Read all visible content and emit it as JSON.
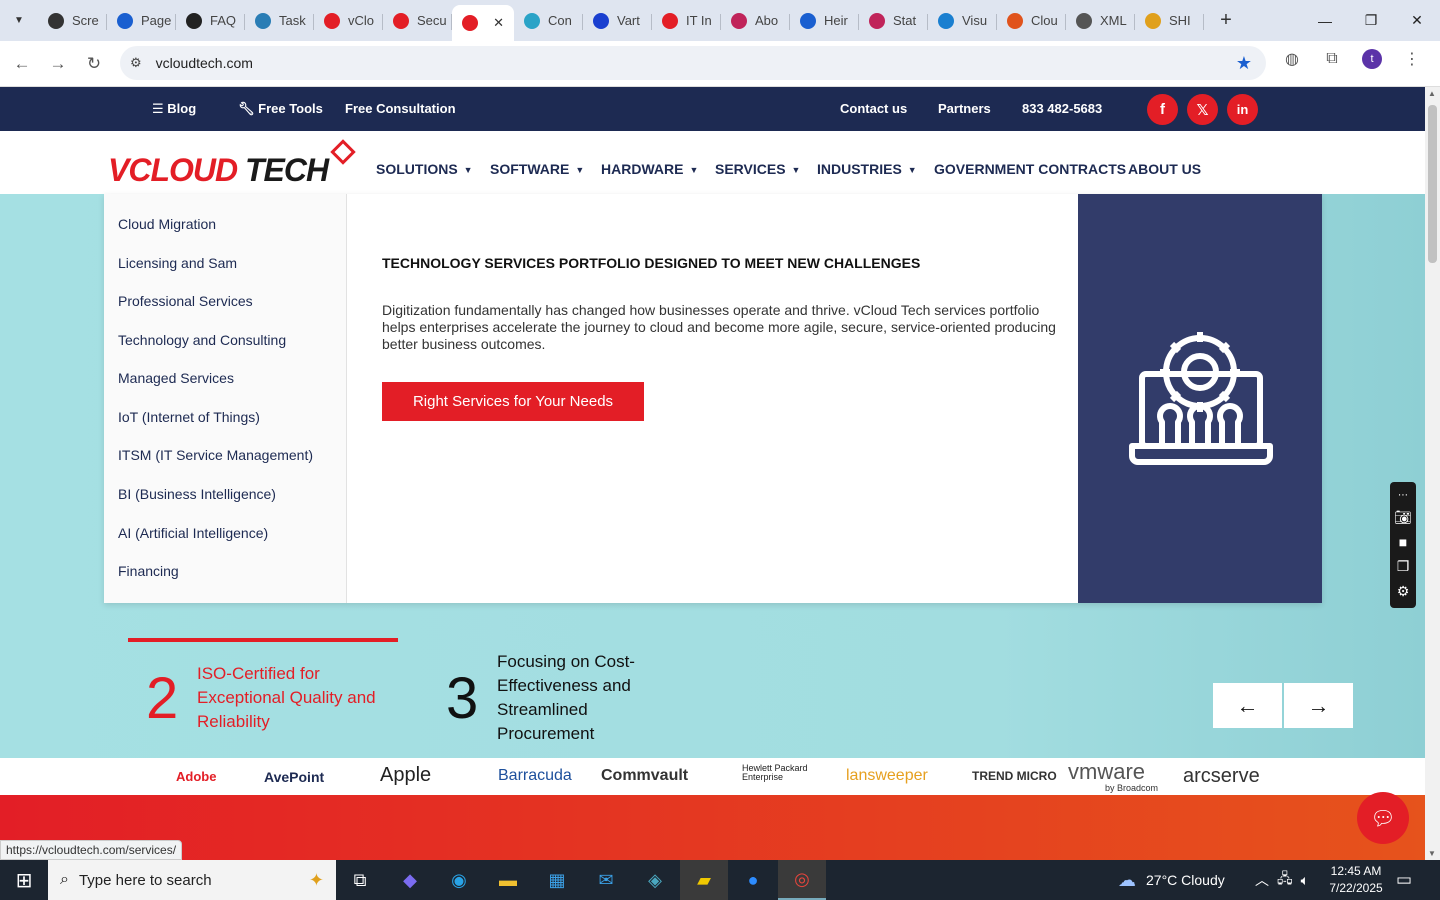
{
  "browser": {
    "tabs": [
      {
        "label": "Scre",
        "color": "#333"
      },
      {
        "label": "Page",
        "color": "#1a5fd0"
      },
      {
        "label": "FAQ",
        "color": "#222"
      },
      {
        "label": "Task",
        "color": "#2a7db5"
      },
      {
        "label": "vClo",
        "color": "#e31e26"
      },
      {
        "label": "Secu",
        "color": "#e31e26"
      },
      {
        "label": "",
        "color": "#e31e26"
      },
      {
        "label": "Con",
        "color": "#2aa3c7"
      },
      {
        "label": "Vart",
        "color": "#1a3fd0"
      },
      {
        "label": "IT In",
        "color": "#e31e26"
      },
      {
        "label": "Abo",
        "color": "#c0245a"
      },
      {
        "label": "Heir",
        "color": "#1a5fd0"
      },
      {
        "label": "Stat",
        "color": "#c0245a"
      },
      {
        "label": "Visu",
        "color": "#1a7fd0"
      },
      {
        "label": "Clou",
        "color": "#e0531c"
      },
      {
        "label": "XML",
        "color": "#555"
      },
      {
        "label": "SHI",
        "color": "#e0a01c"
      }
    ],
    "active_close": "✕",
    "new_tab": "+",
    "url": "vcloudtech.com",
    "status_url": "https://vcloudtech.com/services/",
    "profile_initial": "t"
  },
  "topbar": {
    "blog": "Blog",
    "free_tools": "Free Tools",
    "free_consultation": "Free Consultation",
    "contact": "Contact us",
    "partners": "Partners",
    "phone": "833 482-5683",
    "social": [
      "f",
      "𝕏",
      "in"
    ]
  },
  "logo": {
    "v": "V",
    "cloud": "CLOUD",
    "tech": " TECH"
  },
  "nav": {
    "solutions": "SOLUTIONS",
    "software": "SOFTWARE",
    "hardware": "HARDWARE",
    "services": "SERVICES",
    "industries": "INDUSTRIES",
    "government": "GOVERNMENT CONTRACTS",
    "about": "ABOUT US"
  },
  "services_menu": {
    "items": [
      "Cloud Migration",
      "Licensing and Sam",
      "Professional Services",
      "Technology and Consulting",
      "Managed Services",
      "IoT (Internet of Things)",
      "ITSM (IT Service Management)",
      "BI  (Business Intelligence)",
      "AI  (Artificial Intelligence)",
      "Financing"
    ],
    "title": "TECHNOLOGY SERVICES PORTFOLIO DESIGNED TO MEET NEW CHALLENGES",
    "description": "Digitization fundamentally has changed how businesses operate and thrive. vCloud Tech services portfolio helps enterprises accelerate the journey to cloud and become more agile, secure, service-oriented producing better business outcomes.",
    "cta": "Right Services for Your Needs"
  },
  "stats": [
    {
      "number": "2",
      "text": "ISO-Certified for Exceptional Quality and Reliability"
    },
    {
      "number": "3",
      "text": "Focusing on Cost-Effectiveness and Streamlined Procurement"
    }
  ],
  "carousel": {
    "prev": "←",
    "next": "→"
  },
  "brands": [
    "Adobe",
    "AvePoint",
    "Apple",
    "Barracuda",
    "Commvault",
    "Hewlett Packard Enterprise",
    "lansweeper",
    "TREND MICRO",
    "vmware",
    "arcserve"
  ],
  "vmware_sub": "by Broadcom",
  "taskbar": {
    "search_placeholder": "Type here to search",
    "weather": "27°C  Cloudy",
    "time": "12:45 AM",
    "date": "7/22/2025"
  }
}
